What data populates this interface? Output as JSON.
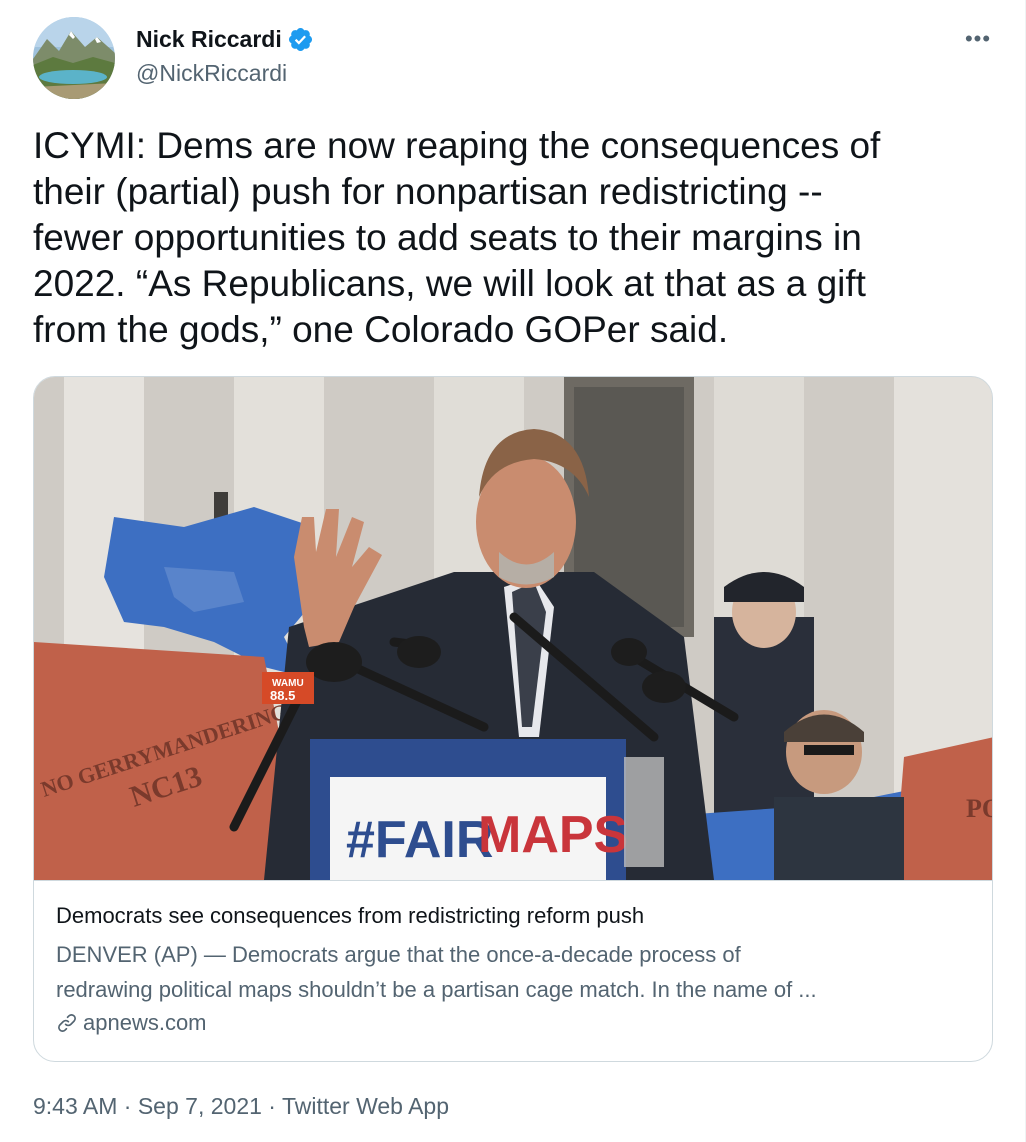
{
  "author": {
    "name": "Nick Riccardi",
    "handle": "@NickRiccardi",
    "verified": true,
    "avatar_icon": "mountain-lake-avatar"
  },
  "more_icon": "more-options-icon",
  "more_label": "•••",
  "tweet": {
    "text": "ICYMI: Dems are now reaping the consequences of\ntheir (partial) push for nonpartisan redistricting --\nfewer opportunities to add seats to their margins in\n2022. “As Republicans, we will look at that as a gift\nfrom the gods,” one Colorado GOPer said."
  },
  "card": {
    "image": {
      "sign_text_fair": "#FAIR",
      "sign_text_maps": "MAPS",
      "mic_flag_station": "WAMU",
      "mic_flag_freq": "88.5",
      "left_sign_text": "NO GERRYMANDERING",
      "left_sign_sub": "NC13",
      "right_sign_text": "PO"
    },
    "title": "Democrats see consequences from redistricting reform push",
    "description_line1": "DENVER (AP) — Democrats argue that the once-a-decade process of",
    "description_line2": "redrawing political maps shouldn’t be a partisan cage match. In the name of ...",
    "domain": "apnews.com",
    "domain_icon": "link-icon"
  },
  "meta": {
    "time": "9:43 AM",
    "date": "Sep 7, 2021",
    "source": "Twitter Web App",
    "separator": "·"
  },
  "colors": {
    "verified_blue": "#1d9bf0",
    "secondary_text": "#536471",
    "primary_text": "#0f1419",
    "border": "#cfd9de",
    "sign_blue": "#2e4d8f",
    "sign_red": "#c9353b"
  }
}
